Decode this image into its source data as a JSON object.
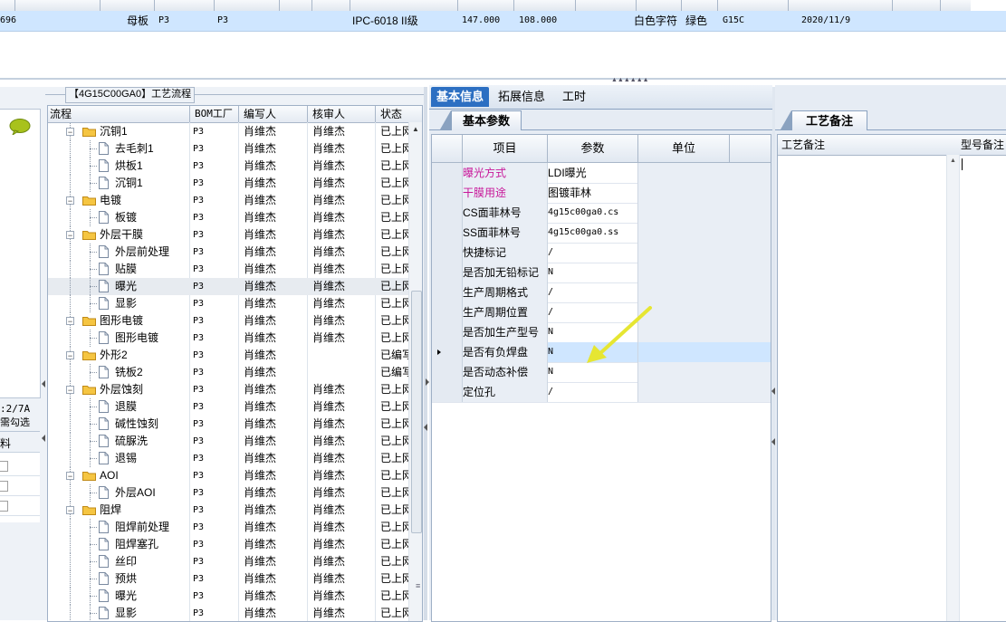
{
  "top_grid": {
    "row": {
      "id": "696",
      "board_type": "母板",
      "factory": "P3",
      "factory2": "P3",
      "grade": "IPC-6018 II级",
      "val1": "147.000",
      "val2": "108.000",
      "char_color": "白色字符",
      "mask_color": "绿色",
      "code": "G15C",
      "date": "2020/11/9"
    }
  },
  "left_stub": {
    "text1": ":2/7A",
    "text2": "需勾选",
    "col_label": "料"
  },
  "tree": {
    "title": "【4G15C00GA0】工艺流程",
    "columns": [
      "流程",
      "BOM工厂",
      "编写人",
      "核审人",
      "状态"
    ],
    "rows": [
      {
        "level": 1,
        "type": "folder",
        "expand": "−",
        "name": "沉铜1",
        "bom": "P3",
        "author": "肖维杰",
        "reviewer": "肖维杰",
        "status": "已上网"
      },
      {
        "level": 2,
        "type": "doc",
        "name": "去毛刺1",
        "bom": "P3",
        "author": "肖维杰",
        "reviewer": "肖维杰",
        "status": "已上网"
      },
      {
        "level": 2,
        "type": "doc",
        "name": "烘板1",
        "bom": "P3",
        "author": "肖维杰",
        "reviewer": "肖维杰",
        "status": "已上网"
      },
      {
        "level": 2,
        "type": "doc",
        "name": "沉铜1",
        "bom": "P3",
        "author": "肖维杰",
        "reviewer": "肖维杰",
        "status": "已上网"
      },
      {
        "level": 1,
        "type": "folder",
        "expand": "−",
        "name": "电镀",
        "bom": "P3",
        "author": "肖维杰",
        "reviewer": "肖维杰",
        "status": "已上网"
      },
      {
        "level": 2,
        "type": "doc",
        "name": "板镀",
        "bom": "P3",
        "author": "肖维杰",
        "reviewer": "肖维杰",
        "status": "已上网"
      },
      {
        "level": 1,
        "type": "folder",
        "expand": "−",
        "name": "外层干膜",
        "bom": "P3",
        "author": "肖维杰",
        "reviewer": "肖维杰",
        "status": "已上网"
      },
      {
        "level": 2,
        "type": "doc",
        "name": "外层前处理",
        "bom": "P3",
        "author": "肖维杰",
        "reviewer": "肖维杰",
        "status": "已上网"
      },
      {
        "level": 2,
        "type": "doc",
        "name": "贴膜",
        "bom": "P3",
        "author": "肖维杰",
        "reviewer": "肖维杰",
        "status": "已上网"
      },
      {
        "level": 2,
        "type": "doc",
        "name": "曝光",
        "bom": "P3",
        "author": "肖维杰",
        "reviewer": "肖维杰",
        "status": "已上网",
        "selected": true
      },
      {
        "level": 2,
        "type": "doc",
        "name": "显影",
        "bom": "P3",
        "author": "肖维杰",
        "reviewer": "肖维杰",
        "status": "已上网"
      },
      {
        "level": 1,
        "type": "folder",
        "expand": "−",
        "name": "图形电镀",
        "bom": "P3",
        "author": "肖维杰",
        "reviewer": "肖维杰",
        "status": "已上网"
      },
      {
        "level": 2,
        "type": "doc",
        "name": "图形电镀",
        "bom": "P3",
        "author": "肖维杰",
        "reviewer": "肖维杰",
        "status": "已上网"
      },
      {
        "level": 1,
        "type": "folder",
        "expand": "−",
        "name": "外形2",
        "bom": "P3",
        "author": "肖维杰",
        "reviewer": "",
        "status": "已编写"
      },
      {
        "level": 2,
        "type": "doc",
        "name": "铣板2",
        "bom": "P3",
        "author": "肖维杰",
        "reviewer": "",
        "status": "已编写"
      },
      {
        "level": 1,
        "type": "folder",
        "expand": "−",
        "name": "外层蚀刻",
        "bom": "P3",
        "author": "肖维杰",
        "reviewer": "肖维杰",
        "status": "已上网"
      },
      {
        "level": 2,
        "type": "doc",
        "name": "退膜",
        "bom": "P3",
        "author": "肖维杰",
        "reviewer": "肖维杰",
        "status": "已上网"
      },
      {
        "level": 2,
        "type": "doc",
        "name": "碱性蚀刻",
        "bom": "P3",
        "author": "肖维杰",
        "reviewer": "肖维杰",
        "status": "已上网"
      },
      {
        "level": 2,
        "type": "doc",
        "name": "硫脲洗",
        "bom": "P3",
        "author": "肖维杰",
        "reviewer": "肖维杰",
        "status": "已上网"
      },
      {
        "level": 2,
        "type": "doc",
        "name": "退锡",
        "bom": "P3",
        "author": "肖维杰",
        "reviewer": "肖维杰",
        "status": "已上网"
      },
      {
        "level": 1,
        "type": "folder",
        "expand": "−",
        "name": "AOI",
        "bom": "P3",
        "author": "肖维杰",
        "reviewer": "肖维杰",
        "status": "已上网"
      },
      {
        "level": 2,
        "type": "doc",
        "name": "外层AOI",
        "bom": "P3",
        "author": "肖维杰",
        "reviewer": "肖维杰",
        "status": "已上网"
      },
      {
        "level": 1,
        "type": "folder",
        "expand": "−",
        "name": "阻焊",
        "bom": "P3",
        "author": "肖维杰",
        "reviewer": "肖维杰",
        "status": "已上网"
      },
      {
        "level": 2,
        "type": "doc",
        "name": "阻焊前处理",
        "bom": "P3",
        "author": "肖维杰",
        "reviewer": "肖维杰",
        "status": "已上网"
      },
      {
        "level": 2,
        "type": "doc",
        "name": "阻焊塞孔",
        "bom": "P3",
        "author": "肖维杰",
        "reviewer": "肖维杰",
        "status": "已上网"
      },
      {
        "level": 2,
        "type": "doc",
        "name": "丝印",
        "bom": "P3",
        "author": "肖维杰",
        "reviewer": "肖维杰",
        "status": "已上网"
      },
      {
        "level": 2,
        "type": "doc",
        "name": "预烘",
        "bom": "P3",
        "author": "肖维杰",
        "reviewer": "肖维杰",
        "status": "已上网"
      },
      {
        "level": 2,
        "type": "doc",
        "name": "曝光",
        "bom": "P3",
        "author": "肖维杰",
        "reviewer": "肖维杰",
        "status": "已上网"
      },
      {
        "level": 2,
        "type": "doc",
        "name": "显影",
        "bom": "P3",
        "author": "肖维杰",
        "reviewer": "肖维杰",
        "status": "已上网"
      }
    ]
  },
  "tabs": [
    "基本信息",
    "拓展信息",
    "工时"
  ],
  "basic": {
    "subtab": "基本参数",
    "columns": [
      "项目",
      "参数",
      "单位"
    ],
    "rows": [
      {
        "item": "曝光方式",
        "value": "LDI曝光",
        "highlight": true
      },
      {
        "item": "干膜用途",
        "value": "图镀菲林",
        "highlight": true
      },
      {
        "item": "CS面菲林号",
        "value": "4g15c00ga0.cs"
      },
      {
        "item": "SS面菲林号",
        "value": "4g15c00ga0.ss"
      },
      {
        "item": "快捷标记",
        "value": "/"
      },
      {
        "item": "是否加无铅标记",
        "value": "N"
      },
      {
        "item": "生产周期格式",
        "value": "/"
      },
      {
        "item": "生产周期位置",
        "value": "/"
      },
      {
        "item": "是否加生产型号",
        "value": "N"
      },
      {
        "item": "是否有负焊盘",
        "value": "N",
        "current": true
      },
      {
        "item": "是否动态补偿",
        "value": "N"
      },
      {
        "item": "定位孔",
        "value": "/"
      }
    ]
  },
  "remarks": {
    "tab": "工艺备注",
    "columns": [
      "工艺备注",
      "型号备注"
    ]
  },
  "colors": {
    "accent": "#2c6fc2",
    "highlight_text": "#c8189a",
    "selection": "#cfe6ff",
    "annotation_arrow": "#e6e632"
  }
}
